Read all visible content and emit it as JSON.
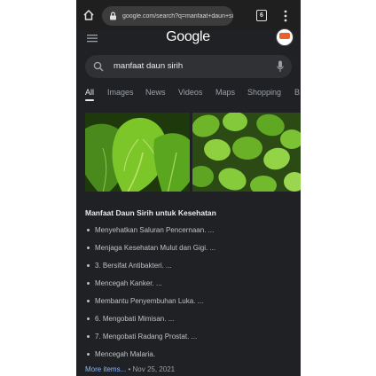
{
  "browser": {
    "url": "google.com/search?q=manfaat+daun+sirih&o",
    "tab_count": "6"
  },
  "header": {
    "logo": "Google"
  },
  "search": {
    "query": "manfaat daun sirih"
  },
  "filters": [
    "All",
    "Images",
    "News",
    "Videos",
    "Maps",
    "Shopping",
    "B"
  ],
  "result": {
    "title": "Manfaat Daun Sirih untuk Kesehatan",
    "items": [
      "Menyehatkan Saluran Pencernaan. ...",
      "Menjaga Kesehatan Mulut dan Gigi. ...",
      "3. Bersifat Antibakteri. ...",
      "Mencegah Kanker. ...",
      "Membantu Penyembuhan Luka. ...",
      "6. Mengobati Mimisan. ...",
      "7. Mengobati Radang Prostat. ...",
      "Mencegah Malaria."
    ],
    "more_label": "More items...",
    "separator": "•",
    "date": "Nov 25, 2021"
  },
  "colors": {
    "background": "#202124",
    "link": "#8ab4f8",
    "text": "#e8eaed"
  }
}
